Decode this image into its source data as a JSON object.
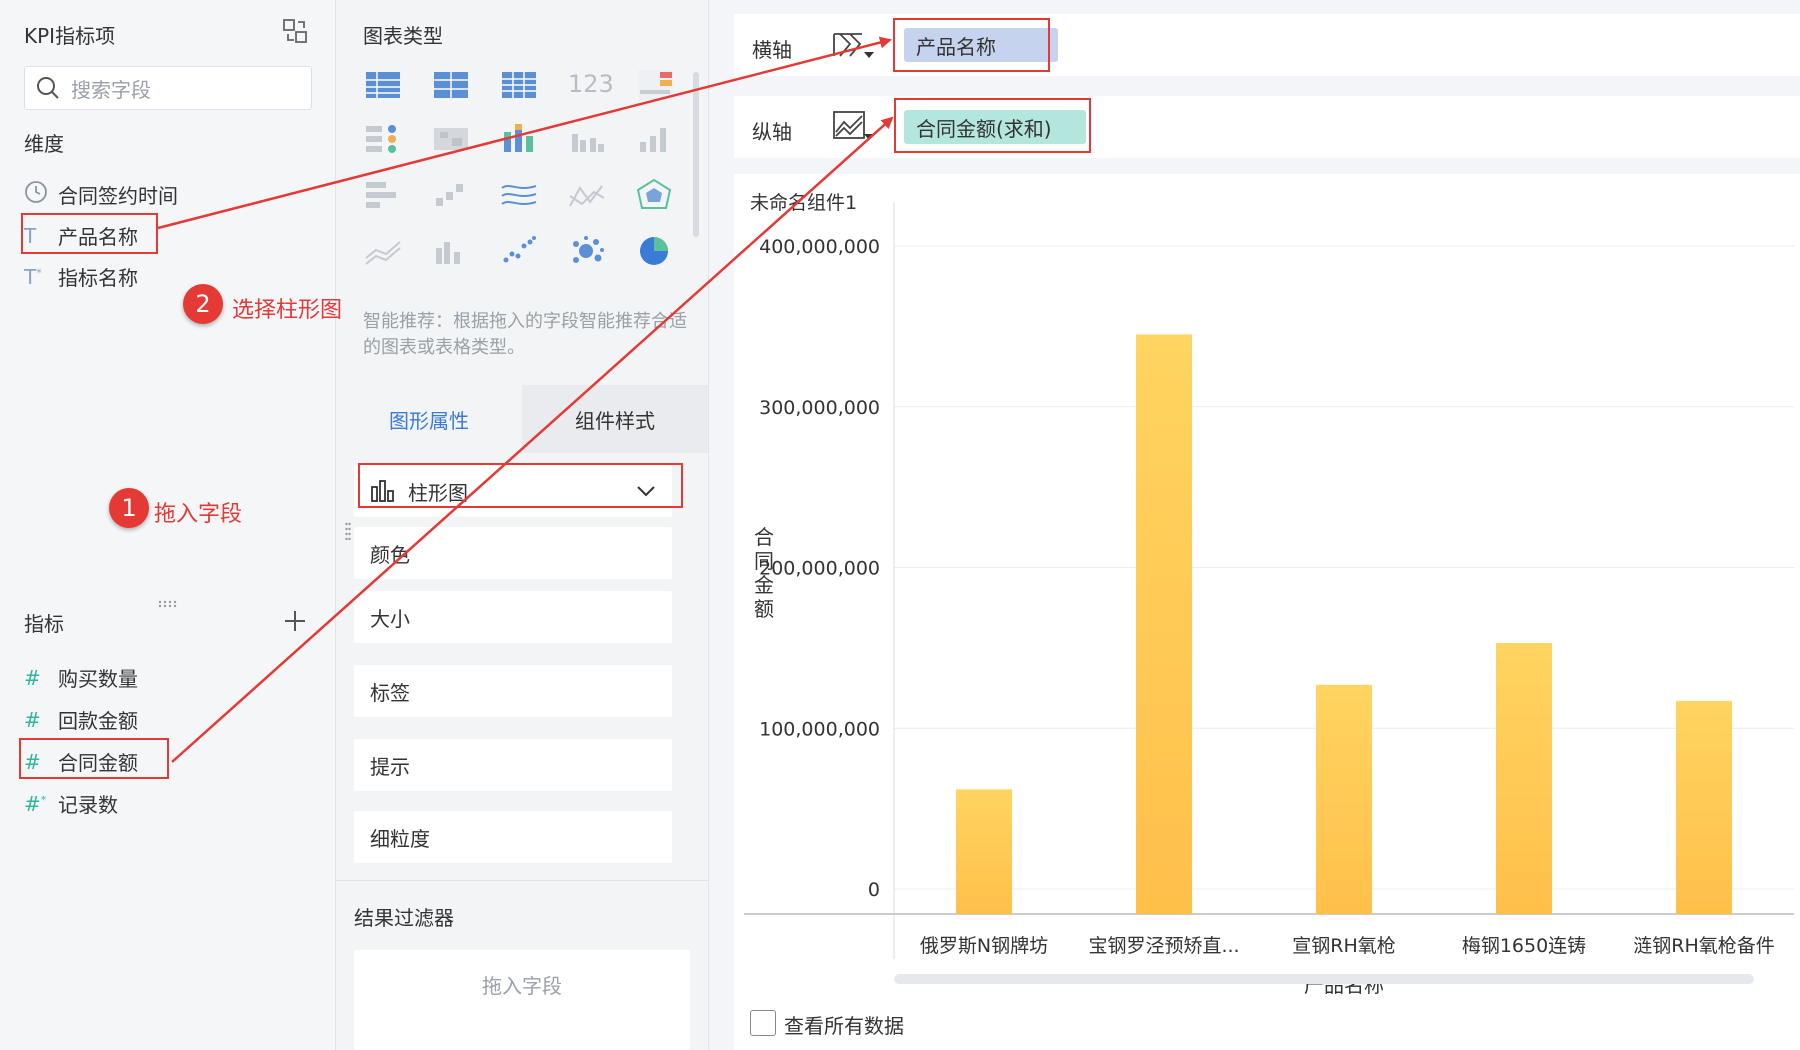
{
  "left": {
    "header": "KPI指标项",
    "search_placeholder": "搜索字段",
    "dimensions_title": "维度",
    "dimensions": [
      {
        "label": "合同签约时间",
        "icon": "clock-icon"
      },
      {
        "label": "产品名称",
        "icon": "text-type-icon"
      },
      {
        "label": "指标名称",
        "icon": "text-type-icon"
      }
    ],
    "measures_title": "指标",
    "measures": [
      {
        "label": "购买数量",
        "icon": "hash-icon"
      },
      {
        "label": "回款金额",
        "icon": "hash-icon"
      },
      {
        "label": "合同金额",
        "icon": "hash-icon"
      },
      {
        "label": "记录数",
        "icon": "hash-icon"
      }
    ]
  },
  "middle": {
    "chart_types_title": "图表类型",
    "tile_123": "123",
    "smart_hint": "智能推荐：根据拖入的字段智能推荐合适的图表或表格类型。",
    "tabs": [
      "图形属性",
      "组件样式"
    ],
    "chart_type_select": "柱形图",
    "properties": [
      "颜色",
      "大小",
      "标签",
      "提示",
      "细粒度"
    ],
    "filter_title": "结果过滤器",
    "filter_drop": "拖入字段"
  },
  "axes": {
    "x_label": "横轴",
    "x_field": "产品名称",
    "y_label": "纵轴",
    "y_field": "合同金额(求和)"
  },
  "widget_title": "未命名组件1",
  "view_all": "查看所有数据",
  "annotations": {
    "step1_num": "1",
    "step1_text": "拖入字段",
    "step2_num": "2",
    "step2_text": "选择柱形图"
  },
  "colors": {
    "accent": "#3a7bd5",
    "annotation_red": "#e53935",
    "bar_top": "#ffd460",
    "bar_bottom": "#ffc04a",
    "x_pill": "#c5d3ee",
    "y_pill": "#b3e6dc"
  },
  "chart_data": {
    "type": "bar",
    "categories": [
      "俄罗斯N钢牌坊",
      "宝钢罗泾预矫直...",
      "宣钢RH氧枪",
      "梅钢1650连铸",
      "涟钢RH氧枪备件"
    ],
    "values": [
      62000000,
      345000000,
      127000000,
      153000000,
      117000000
    ],
    "xlabel": "产品名称",
    "ylabel": "合同金额",
    "ylim": [
      0,
      400000000
    ],
    "yticks": [
      0,
      100000000,
      200000000,
      300000000,
      400000000
    ],
    "ytick_labels": [
      "0",
      "100,000,000",
      "200,000,000",
      "300,000,000",
      "400,000,000"
    ],
    "grid": true
  }
}
